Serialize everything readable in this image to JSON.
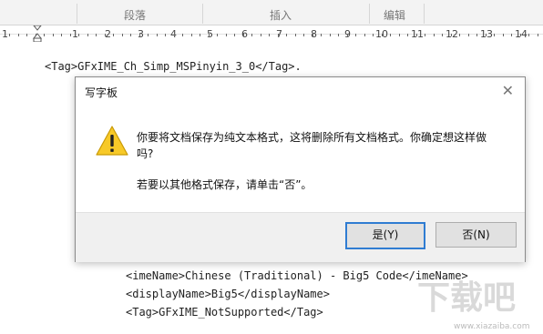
{
  "ribbon": {
    "groups": [
      "段落",
      "插入",
      "编辑"
    ]
  },
  "ruler": {
    "numbers": [
      "1",
      "1",
      "2",
      "3",
      "4",
      "5",
      "6",
      "7",
      "8",
      "9",
      "10",
      "11",
      "12",
      "13",
      "14"
    ]
  },
  "document": {
    "line1": "<Tag>GFxIME_Ch_Simp_MSPinyin_3_0</Tag>.",
    "line2": "<imeName>Chinese (Traditional) - Big5 Code</imeName>",
    "line3": "<displayName>Big5</displayName>",
    "line4": "<Tag>GFxIME_NotSupported</Tag>"
  },
  "dialog": {
    "title": "写字板",
    "close_glyph": "✕",
    "message_line1": "你要将文档保存为纯文本格式，这将删除所有文档格式。你确定想这样做",
    "message_line2": "吗?",
    "message_secondary": "若要以其他格式保存，请单击“否”。",
    "yes_label": "是(Y)",
    "no_label": "否(N)"
  },
  "watermark": {
    "text": "下载吧",
    "url": "www.xiazaiba.com"
  }
}
